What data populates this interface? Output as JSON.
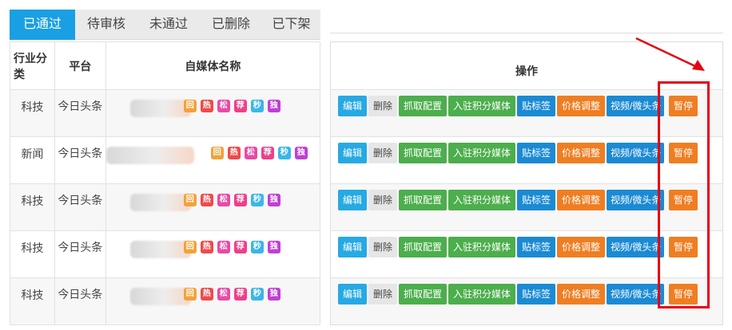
{
  "tabs": [
    {
      "label": "已通过",
      "active": true
    },
    {
      "label": "待审核",
      "active": false
    },
    {
      "label": "未通过",
      "active": false
    },
    {
      "label": "已删除",
      "active": false
    },
    {
      "label": "已下架",
      "active": false
    }
  ],
  "left_table": {
    "headers": {
      "industry": "行业分类",
      "platform": "平台",
      "name": "自媒体名称"
    },
    "rows": [
      {
        "industry": "科技",
        "platform": "今日头条"
      },
      {
        "industry": "新闻",
        "platform": "今日头条"
      },
      {
        "industry": "科技",
        "platform": "今日头条"
      },
      {
        "industry": "科技",
        "platform": "今日头条"
      },
      {
        "industry": "科技",
        "platform": "今日头条"
      }
    ]
  },
  "badges": [
    {
      "label": "回",
      "color": "#f2a23a"
    },
    {
      "label": "热",
      "color": "#f04a4a"
    },
    {
      "label": "松",
      "color": "#e84aa6"
    },
    {
      "label": "荐",
      "color": "#ee3f8b"
    },
    {
      "label": "秒",
      "color": "#3bb6e8"
    },
    {
      "label": "独",
      "color": "#c13fd6"
    }
  ],
  "right_table": {
    "header": "操作",
    "buttons": {
      "edit": "编辑",
      "delete": "删除",
      "grab": "抓取配置",
      "join": "入驻积分媒体",
      "tag": "贴标签",
      "price": "价格调整",
      "video": "视频/微头条",
      "pause": "暂停"
    }
  },
  "annotation": {
    "color": "#e60012"
  }
}
